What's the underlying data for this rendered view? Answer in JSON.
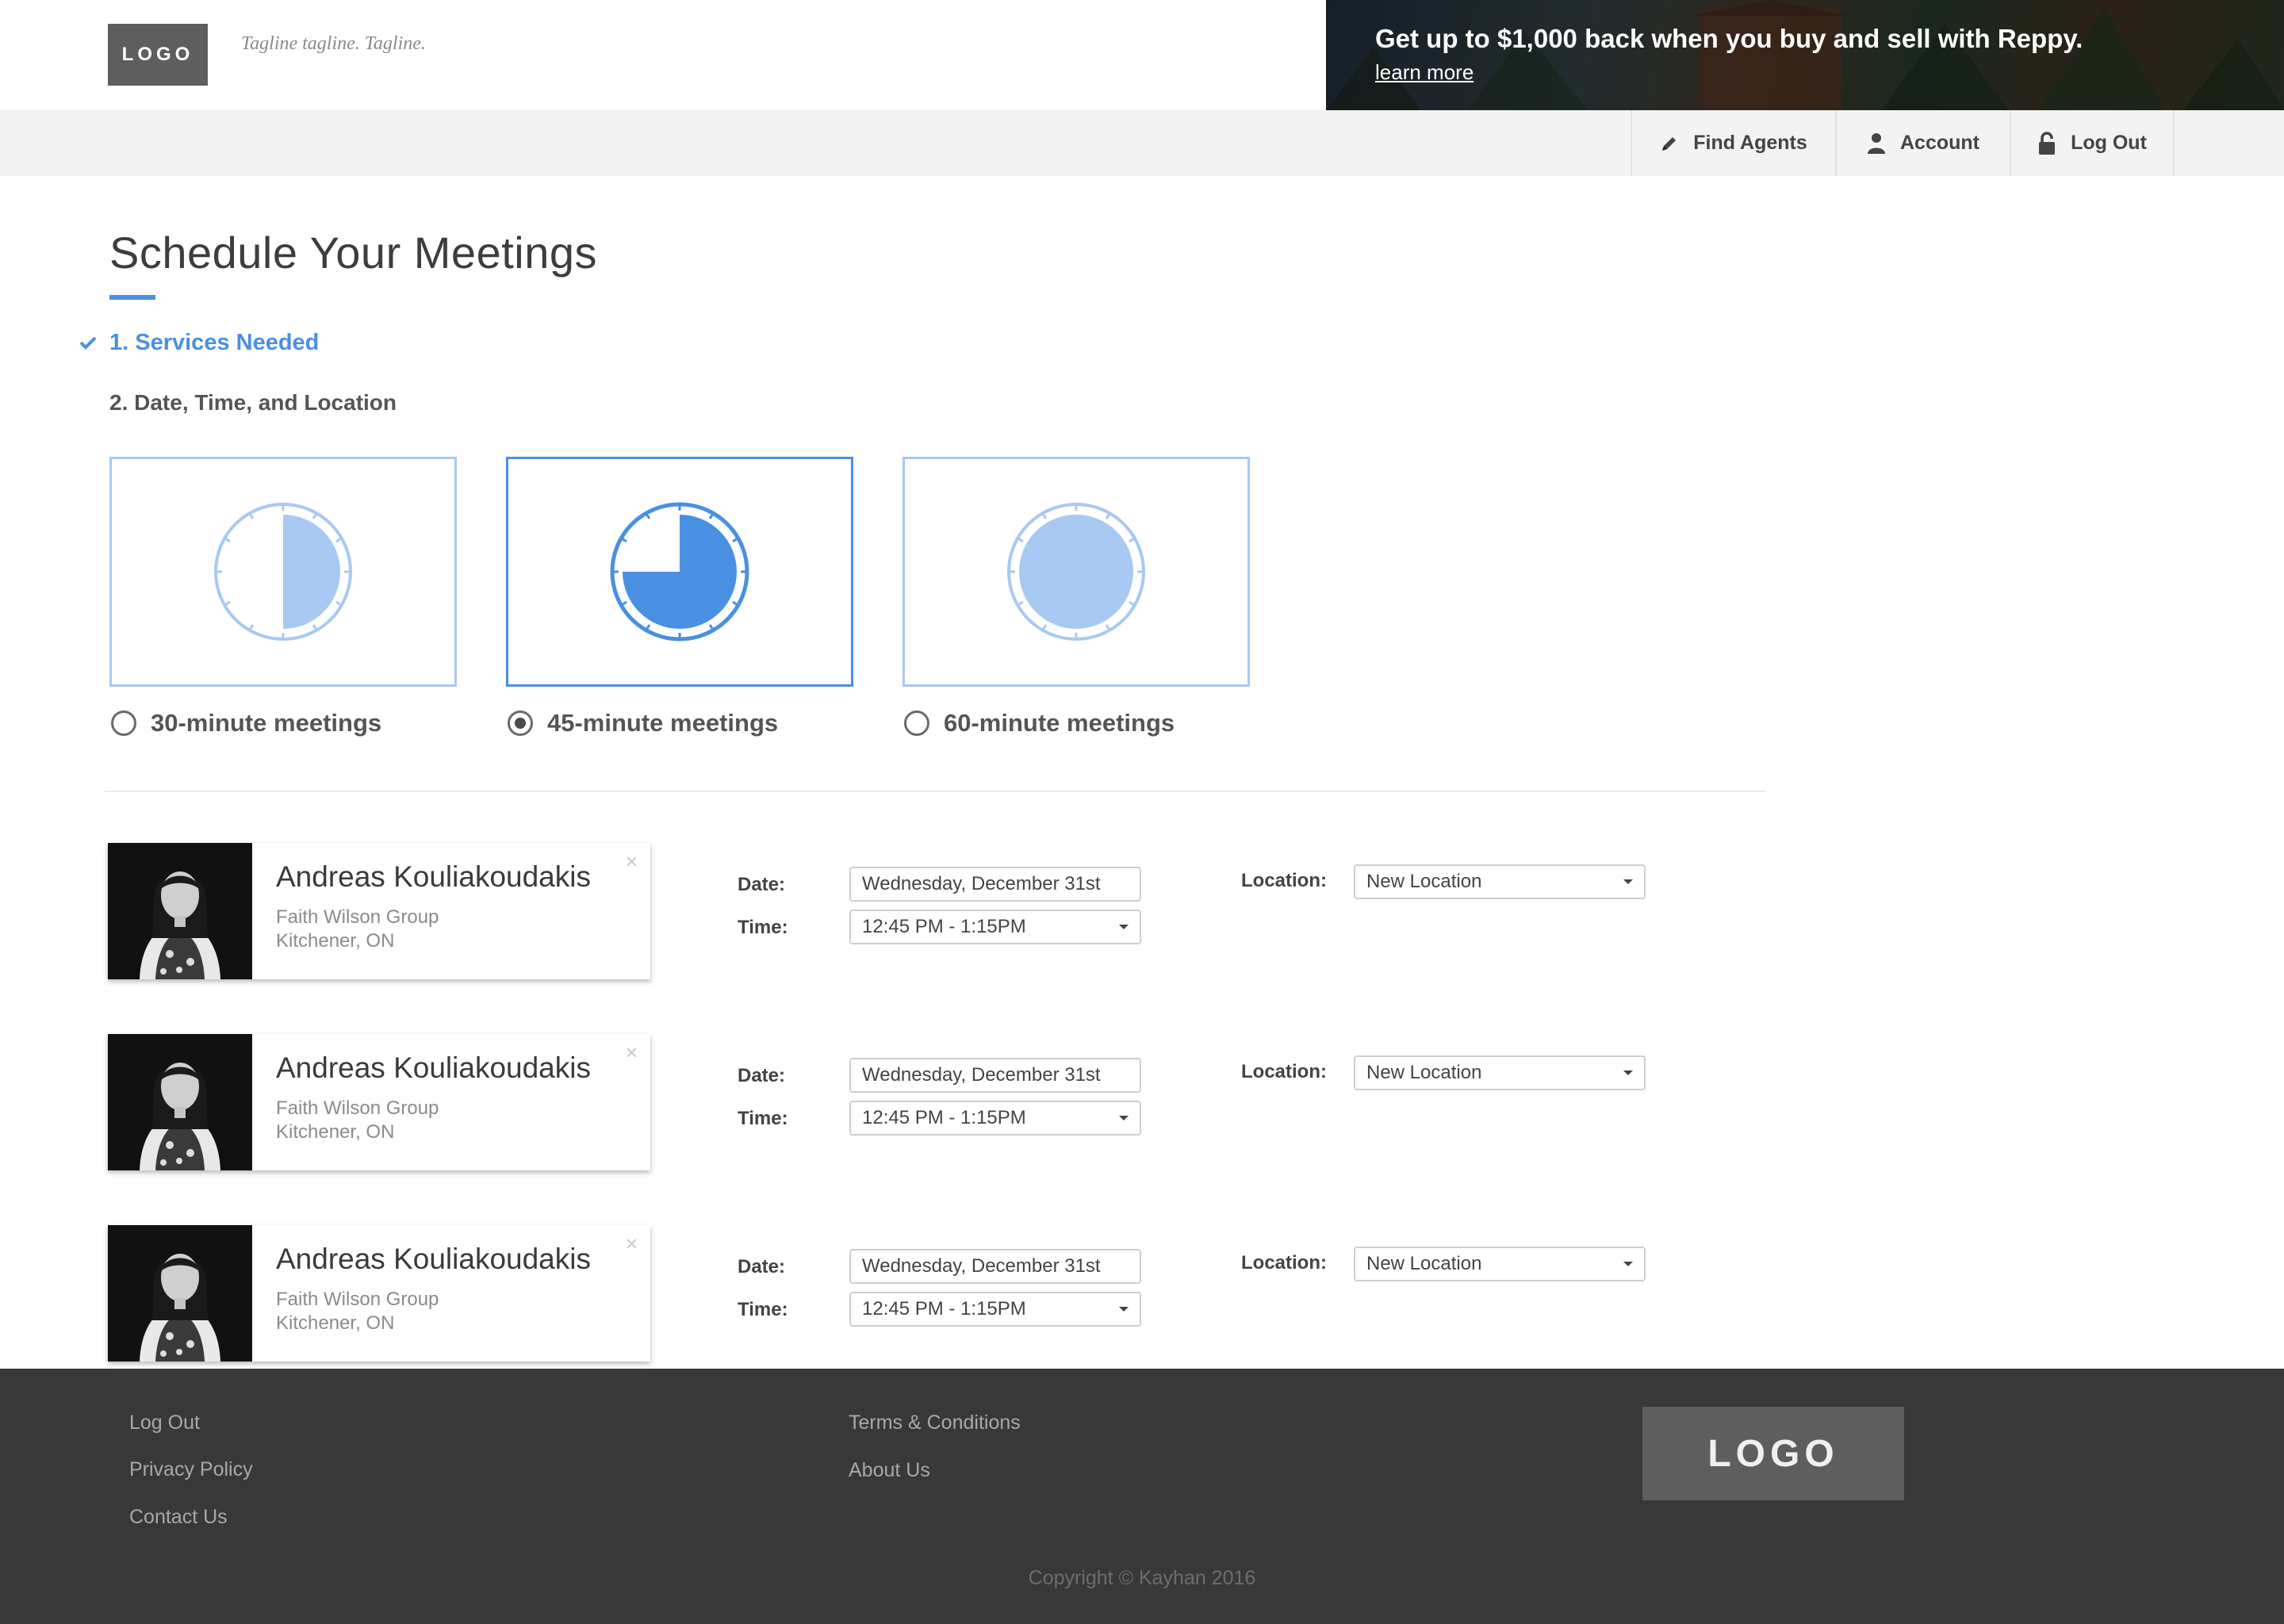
{
  "header": {
    "logo": "LOGO",
    "tagline": "Tagline tagline. Tagline.",
    "promo": {
      "title": "Get up to $1,000 back when you buy and sell with Reppy.",
      "link": "learn more"
    }
  },
  "nav": {
    "items": [
      {
        "label": "Find Agents",
        "icon": "pencil-icon"
      },
      {
        "label": "Account",
        "icon": "user-icon"
      },
      {
        "label": "Log Out",
        "icon": "lock-icon"
      }
    ]
  },
  "main": {
    "title": "Schedule Your Meetings",
    "steps": [
      {
        "label": "1. Services Needed",
        "completed": true
      },
      {
        "label": "2. Date, Time, and Location",
        "completed": false
      }
    ],
    "durations": [
      {
        "label": "30-minute meetings",
        "selected": false,
        "fill_fraction": 0.5
      },
      {
        "label": "45-minute meetings",
        "selected": true,
        "fill_fraction": 0.75
      },
      {
        "label": "60-minute meetings",
        "selected": false,
        "fill_fraction": 1.0
      }
    ],
    "meetings": [
      {
        "agent_name": "Andreas Kouliakoudakis",
        "agent_group": "Faith Wilson Group",
        "agent_location": "Kitchener, ON",
        "date_label": "Date:",
        "date_value": "Wednesday, December 31st",
        "time_label": "Time:",
        "time_value": "12:45 PM - 1:15PM",
        "location_label": "Location:",
        "location_value": "New Location"
      },
      {
        "agent_name": "Andreas Kouliakoudakis",
        "agent_group": "Faith Wilson Group",
        "agent_location": "Kitchener, ON",
        "date_label": "Date:",
        "date_value": "Wednesday, December 31st",
        "time_label": "Time:",
        "time_value": "12:45 PM - 1:15PM",
        "location_label": "Location:",
        "location_value": "New Location"
      },
      {
        "agent_name": "Andreas Kouliakoudakis",
        "agent_group": "Faith Wilson Group",
        "agent_location": "Kitchener, ON",
        "date_label": "Date:",
        "date_value": "Wednesday, December 31st",
        "time_label": "Time:",
        "time_value": "12:45 PM - 1:15PM",
        "location_label": "Location:",
        "location_value": "New Location"
      }
    ]
  },
  "footer": {
    "links_col1": [
      "Log Out",
      "Privacy Policy",
      "Contact Us"
    ],
    "links_col2": [
      "Terms & Conditions",
      "About Us"
    ],
    "logo": "LOGO",
    "copyright": "Copyright © Kayhan 2016"
  },
  "colors": {
    "accent": "#4a90e2",
    "accent_light": "#a8c9f1",
    "footer_bg": "#383838",
    "logo_bg": "#5e5e5e"
  }
}
